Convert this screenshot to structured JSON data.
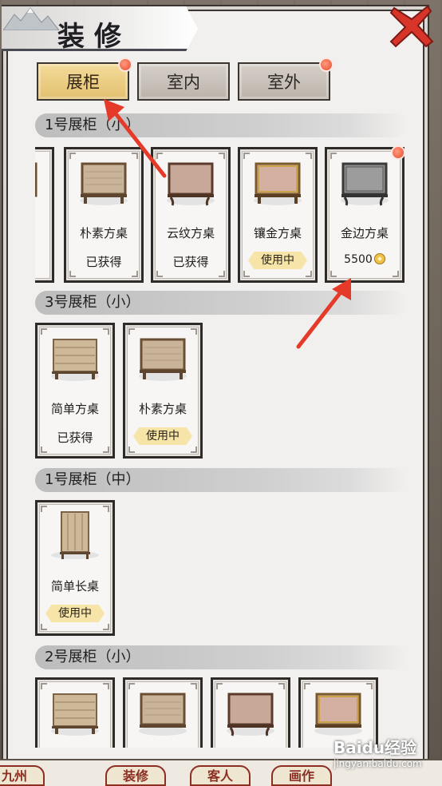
{
  "title": "装修",
  "tabs": [
    {
      "label": "展柜",
      "active": true,
      "badge": true
    },
    {
      "label": "室内",
      "active": false,
      "badge": false
    },
    {
      "label": "室外",
      "active": false,
      "badge": true
    }
  ],
  "sections": [
    {
      "title": "1号展柜（小）",
      "items": [
        {
          "name": "朴素方桌",
          "status": "已获得",
          "state": "owned",
          "style": "plain"
        },
        {
          "name": "云纹方桌",
          "status": "已获得",
          "state": "owned",
          "style": "cloud"
        },
        {
          "name": "镶金方桌",
          "status": "使用中",
          "state": "in_use",
          "style": "gold"
        },
        {
          "name": "金边方桌",
          "price": "5500",
          "state": "price",
          "style": "iron",
          "badge": true
        }
      ]
    },
    {
      "title": "3号展柜（小）",
      "items": [
        {
          "name": "简单方桌",
          "status": "已获得",
          "state": "owned",
          "style": "simple"
        },
        {
          "name": "朴素方桌",
          "status": "使用中",
          "state": "in_use",
          "style": "plain"
        }
      ]
    },
    {
      "title": "1号展柜（中）",
      "items": [
        {
          "name": "简单长桌",
          "status": "使用中",
          "state": "in_use",
          "style": "tall"
        }
      ]
    },
    {
      "title": "2号展柜（小）",
      "items": [
        {
          "style": "simple"
        },
        {
          "style": "plain"
        },
        {
          "style": "cloud"
        },
        {
          "style": "gold"
        }
      ]
    }
  ],
  "bottom_nav": [
    "九州",
    "装修",
    "客人",
    "画作"
  ],
  "watermark": {
    "logo": "Baidu经验",
    "url": "jingyan.baidu.com"
  },
  "colors": {
    "active_tab": "#e8c97a",
    "badge": "#e84c2e",
    "in_use_tag": "#f7e4a8",
    "arrow": "#e53a2a"
  }
}
